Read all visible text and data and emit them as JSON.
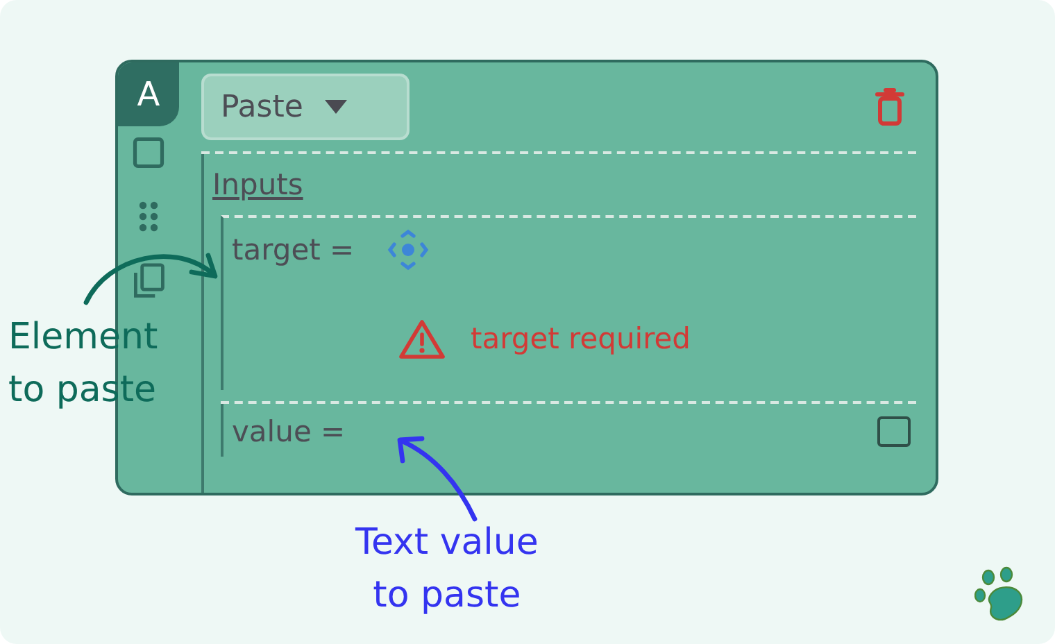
{
  "block": {
    "badge": "A",
    "dropdown": {
      "label": "Paste"
    },
    "section": "Inputs",
    "inputs": [
      {
        "label": "target =",
        "kind": "element",
        "error": "target required"
      },
      {
        "label": "value =",
        "kind": "text",
        "checked": false
      }
    ]
  },
  "annotations": [
    {
      "text": "Element\nto paste",
      "color": "#0e6b5a"
    },
    {
      "text": "Text value\nto paste",
      "color": "#3434f0"
    }
  ]
}
